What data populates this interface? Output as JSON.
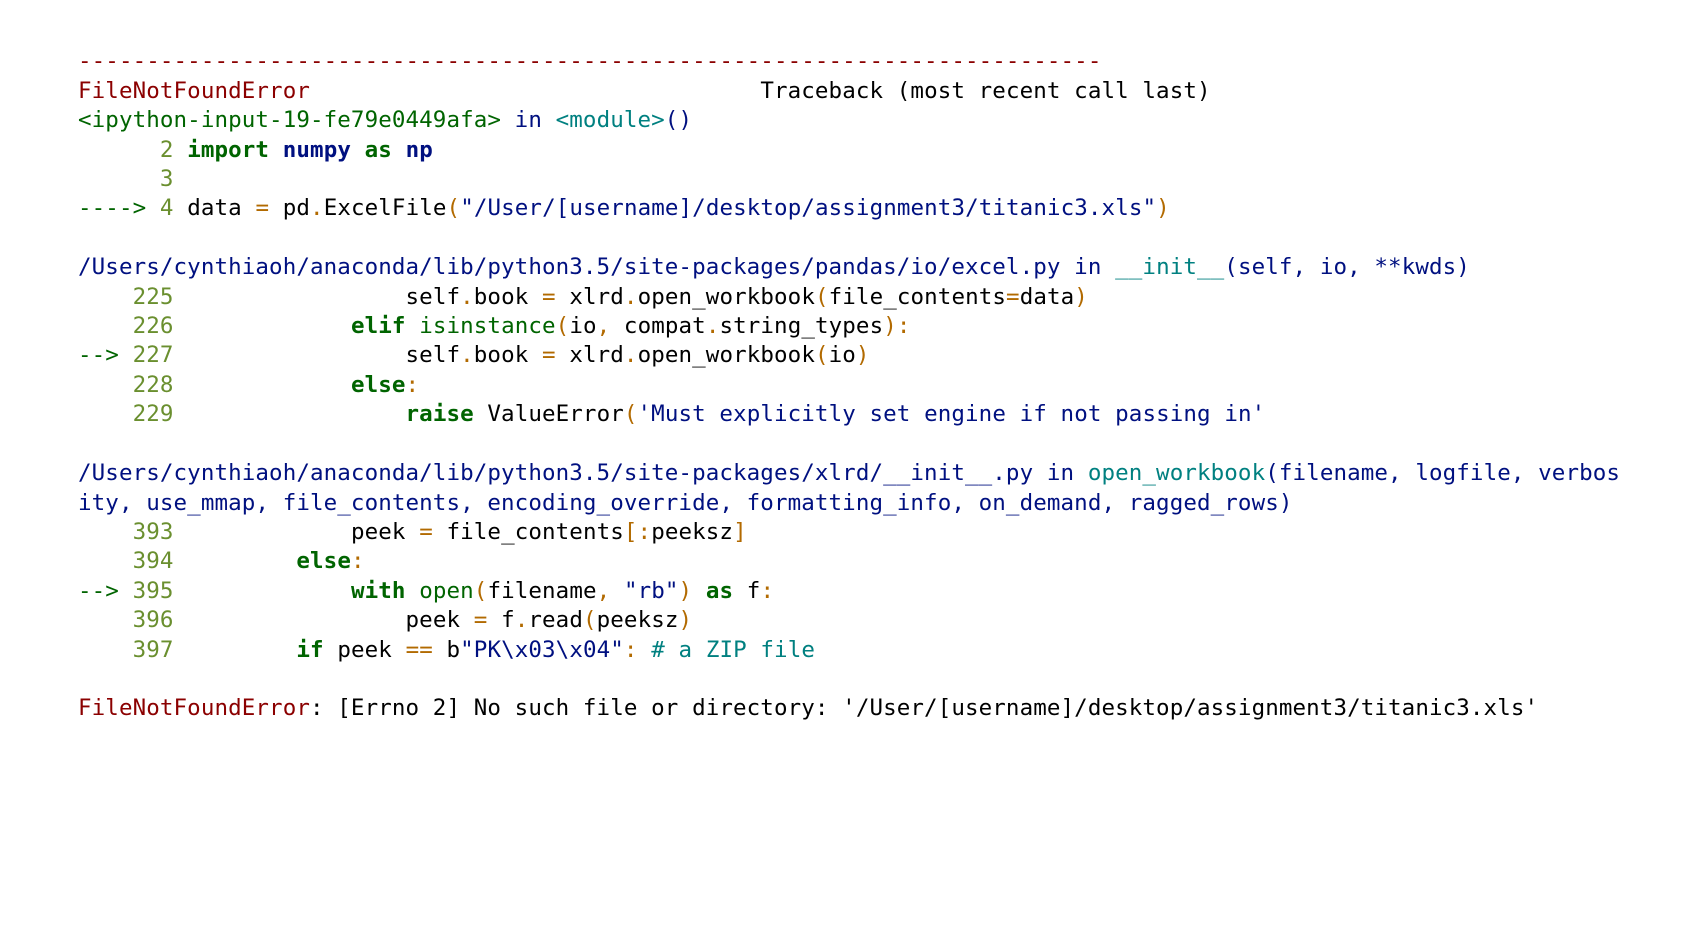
{
  "traceback": {
    "dash_line": "---------------------------------------------------------------------------",
    "error_name": "FileNotFoundError",
    "header_right": "Traceback (most recent call last)",
    "frame1": {
      "location": "<ipython-input-19-fe79e0449afa>",
      "in": " in ",
      "module": "<module>",
      "parens": "()",
      "lines": [
        {
          "marker": "      ",
          "no": "2",
          "pre": " ",
          "kw_import": "import",
          "sp1": " ",
          "mod_numpy": "numpy",
          "sp2": " ",
          "kw_as": "as",
          "sp3": " ",
          "alias_np": "np"
        },
        {
          "marker": "      ",
          "no": "3",
          "rest": " "
        },
        {
          "marker": "----> ",
          "no": "4",
          "pre": " data ",
          "op_eq": "=",
          "sp1": " pd",
          "dot": ".",
          "fn": "ExcelFile",
          "lp": "(",
          "str": "\"/User/[username]/desktop/assignment3/titanic3.xls\"",
          "rp": ")"
        }
      ]
    },
    "frame2": {
      "path": "/Users/cynthiaoh/anaconda/lib/python3.5/site-packages/pandas/io/excel.py",
      "in": " in ",
      "func": "__init__",
      "sig": "(self, io, **kwds)",
      "lines": [
        {
          "marker": "    ",
          "no": "225",
          "indent": "                 self",
          "dot": ".",
          "attr": "book ",
          "op_eq": "=",
          "rest": " xlrd",
          "dot2": ".",
          "fn": "open_workbook",
          "lp": "(",
          "kwarg": "file_contents",
          "eq2": "=",
          "arg": "data",
          "rp": ")"
        },
        {
          "marker": "    ",
          "no": "226",
          "indent": "             ",
          "kw_elif": "elif",
          "sp": " ",
          "fn_isinstance": "isinstance",
          "lp": "(",
          "a1": "io",
          "comma": ",",
          "sp2": " compat",
          "dot": ".",
          "a2": "string_types",
          "rp": ")",
          "colon": ":"
        },
        {
          "marker": "--> ",
          "no": "227",
          "indent": "                 self",
          "dot": ".",
          "attr": "book ",
          "op_eq": "=",
          "rest": " xlrd",
          "dot2": ".",
          "fn": "open_workbook",
          "lp": "(",
          "arg": "io",
          "rp": ")"
        },
        {
          "marker": "    ",
          "no": "228",
          "indent": "             ",
          "kw_else": "else",
          "colon": ":"
        },
        {
          "marker": "    ",
          "no": "229",
          "indent": "                 ",
          "kw_raise": "raise",
          "sp": " ValueError",
          "lp": "(",
          "str": "'Must explicitly set engine if not passing in'"
        }
      ]
    },
    "frame3": {
      "path": "/Users/cynthiaoh/anaconda/lib/python3.5/site-packages/xlrd/__init__.py",
      "in": " in ",
      "func": "open_workbook",
      "sig": "(filename, logfile, verbosity, use_mmap, file_contents, encoding_override, formatting_info, on_demand, ragged_rows)",
      "lines": [
        {
          "marker": "    ",
          "no": "393",
          "indent": "             peek ",
          "op_eq": "=",
          "rest": " file_contents",
          "lb": "[",
          "colon": ":",
          "idx": "peeksz",
          "rb": "]"
        },
        {
          "marker": "    ",
          "no": "394",
          "indent": "         ",
          "kw_else": "else",
          "colon": ":"
        },
        {
          "marker": "--> ",
          "no": "395",
          "indent": "             ",
          "kw_with": "with",
          "sp": " ",
          "fn_open": "open",
          "lp": "(",
          "a1": "filename",
          "comma": ",",
          "sp2": " ",
          "str": "\"rb\"",
          "rp": ")",
          "sp3": " ",
          "kw_as": "as",
          "sp4": " f",
          "colon": ":"
        },
        {
          "marker": "    ",
          "no": "396",
          "indent": "                 peek ",
          "op_eq": "=",
          "rest": " f",
          "dot": ".",
          "fn": "read",
          "lp": "(",
          "arg": "peeksz",
          "rp": ")"
        },
        {
          "marker": "    ",
          "no": "397",
          "indent": "         ",
          "kw_if": "if",
          "body": " peek ",
          "op_eq": "==",
          "sp": " b",
          "str": "\"PK\\x03\\x04\"",
          "col": ":",
          "sp2": " ",
          "comment": "# a ZIP file"
        }
      ]
    },
    "final": {
      "prefix": "FileNotFoundError",
      "rest": ": [Errno 2] No such file or directory: '/User/[username]/desktop/assignment3/titanic3.xls'"
    }
  }
}
